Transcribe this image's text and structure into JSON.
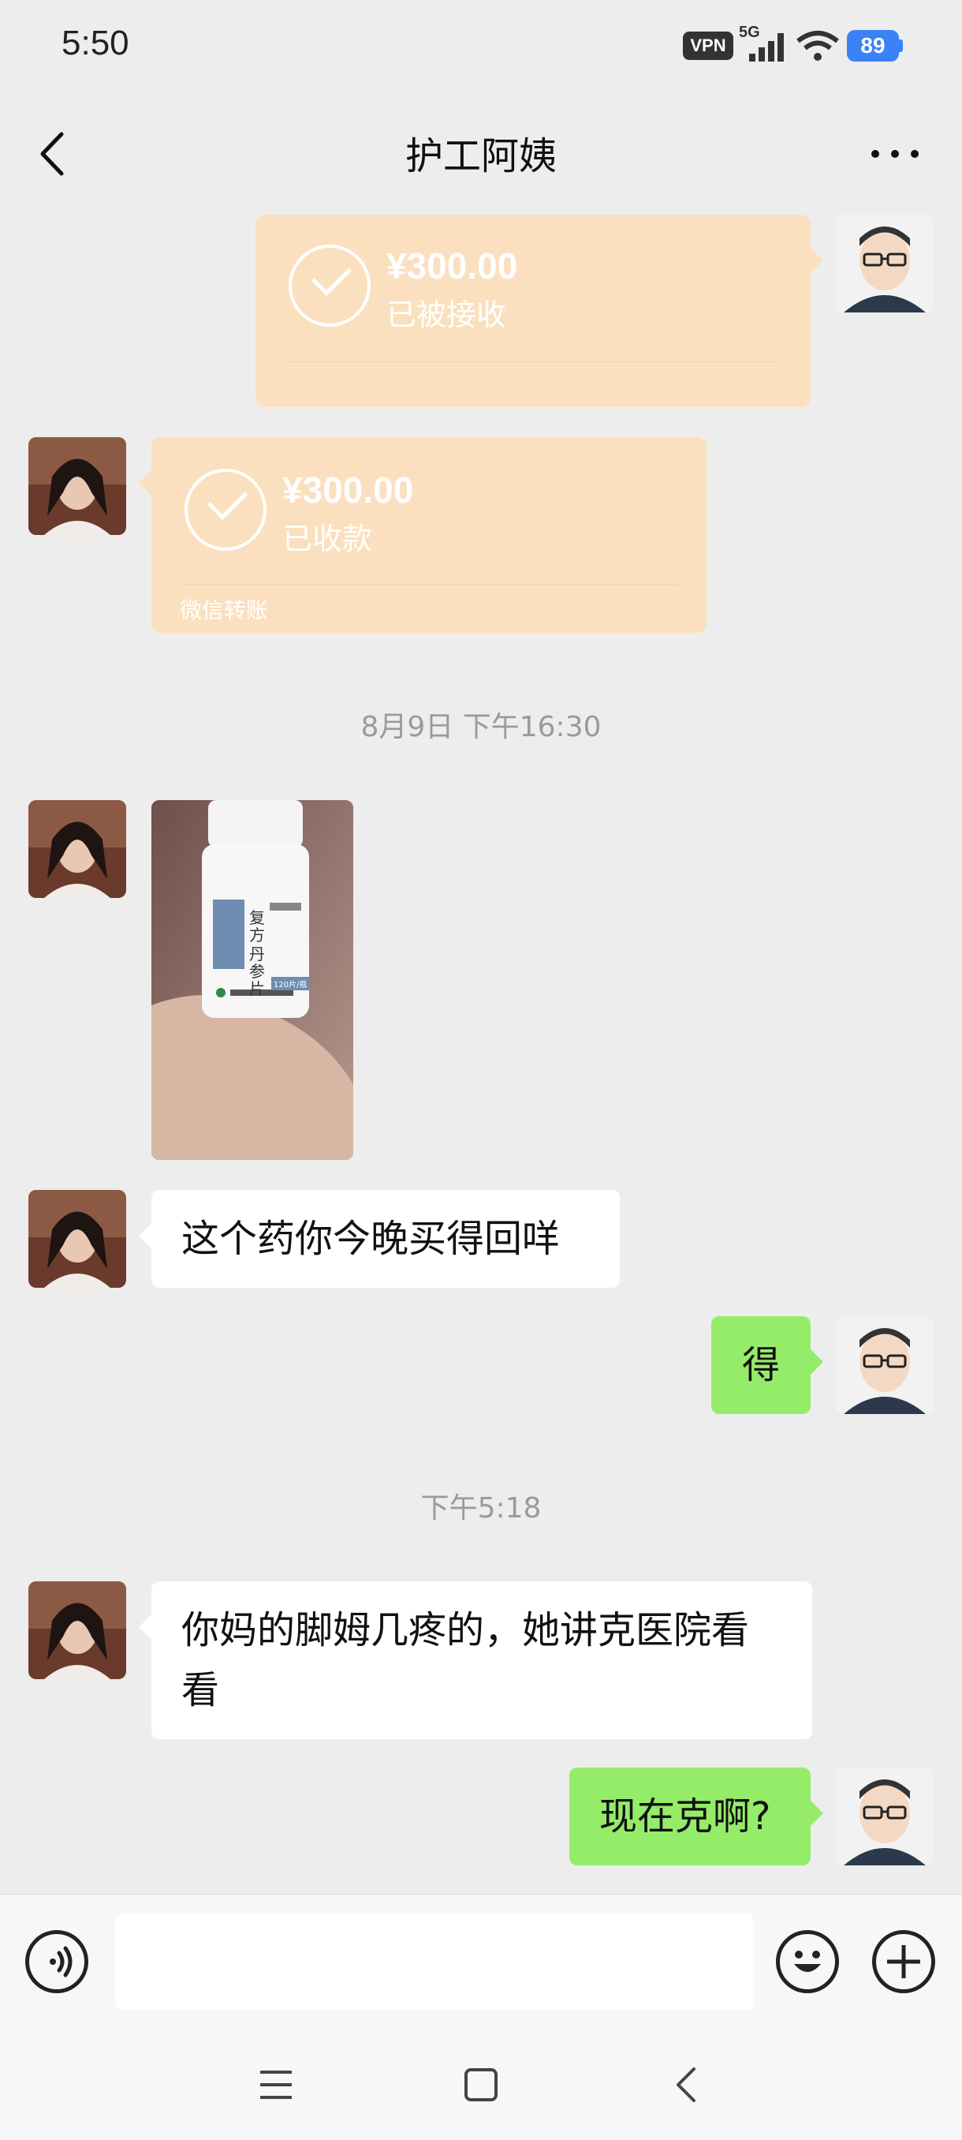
{
  "status_bar": {
    "time": "5:50",
    "vpn": "VPN",
    "network": "5G",
    "battery": "89"
  },
  "header": {
    "title": "护工阿姨",
    "back_icon": "chevron-left-icon",
    "more_icon": "more-dots-icon"
  },
  "messages": {
    "transfer_sent": {
      "amount": "¥300.00",
      "status": "已被接收"
    },
    "transfer_received": {
      "amount": "¥300.00",
      "status": "已收款",
      "footer": "微信转账"
    },
    "time_1": "8月9日 下午16:30",
    "image_message": {
      "label_line1": "复方",
      "label_line2": "丹参片",
      "badge": "120片/瓶"
    },
    "text_1": "这个药你今晚买得回咩",
    "reply_1": "得",
    "time_2": "下午5:18",
    "text_2": "你妈的脚姆几疼的，她讲克医院看看",
    "reply_2": "现在克啊?"
  },
  "input_bar": {
    "voice_icon": "voice-icon",
    "emoji_icon": "emoji-icon",
    "plus_icon": "plus-icon"
  },
  "colors": {
    "background": "#ededed",
    "transfer_card": "#fbe0bf",
    "sent_bubble": "#95ec69",
    "received_bubble": "#ffffff",
    "battery": "#3b82f6"
  }
}
